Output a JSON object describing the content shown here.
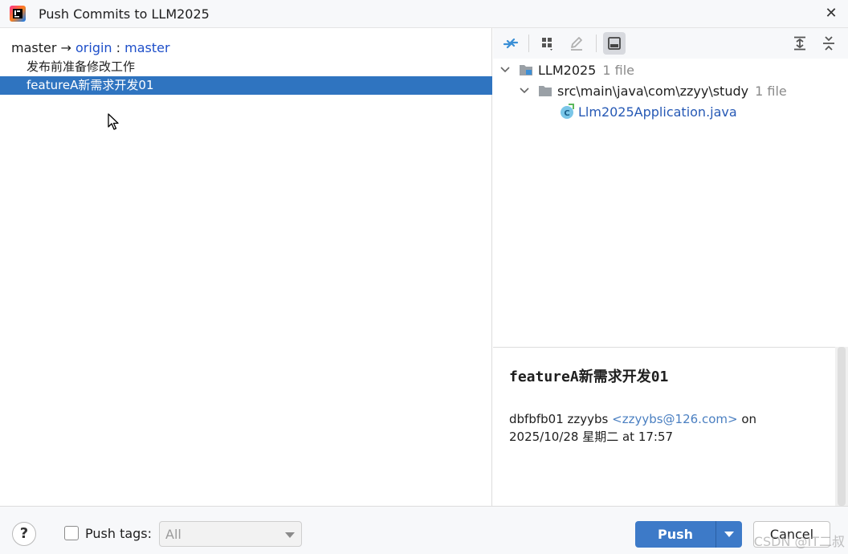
{
  "window": {
    "title": "Push Commits to LLM2025"
  },
  "branch": {
    "local": "master",
    "arrow": "→",
    "remote": "origin",
    "separator": " : ",
    "remote_branch": "master"
  },
  "commits": [
    {
      "message": "发布前准备修改工作",
      "selected": false
    },
    {
      "message": "featureA新需求开发01",
      "selected": true
    }
  ],
  "file_tree": {
    "root": {
      "name": "LLM2025",
      "count": "1 file"
    },
    "folder": {
      "name": "src\\main\\java\\com\\zzyy\\study",
      "count": "1 file"
    },
    "file": {
      "name": "Llm2025Application.java"
    }
  },
  "details": {
    "title": "featureA新需求开发01",
    "hash": "dbfbfb01",
    "author": "zzyybs",
    "email": "<zzyybs@126.com>",
    "on_word": "on",
    "date": "2025/10/28 星期二 at 17:57"
  },
  "footer": {
    "help": "?",
    "push_tags_label": "Push tags:",
    "push_tags_value": "All",
    "push_label": "Push",
    "cancel_label": "Cancel",
    "watermark": "CSDN @IT二叔"
  },
  "colors": {
    "selection": "#2f74c0",
    "link": "#1e4fc9",
    "push_button": "#3d7ac8"
  }
}
